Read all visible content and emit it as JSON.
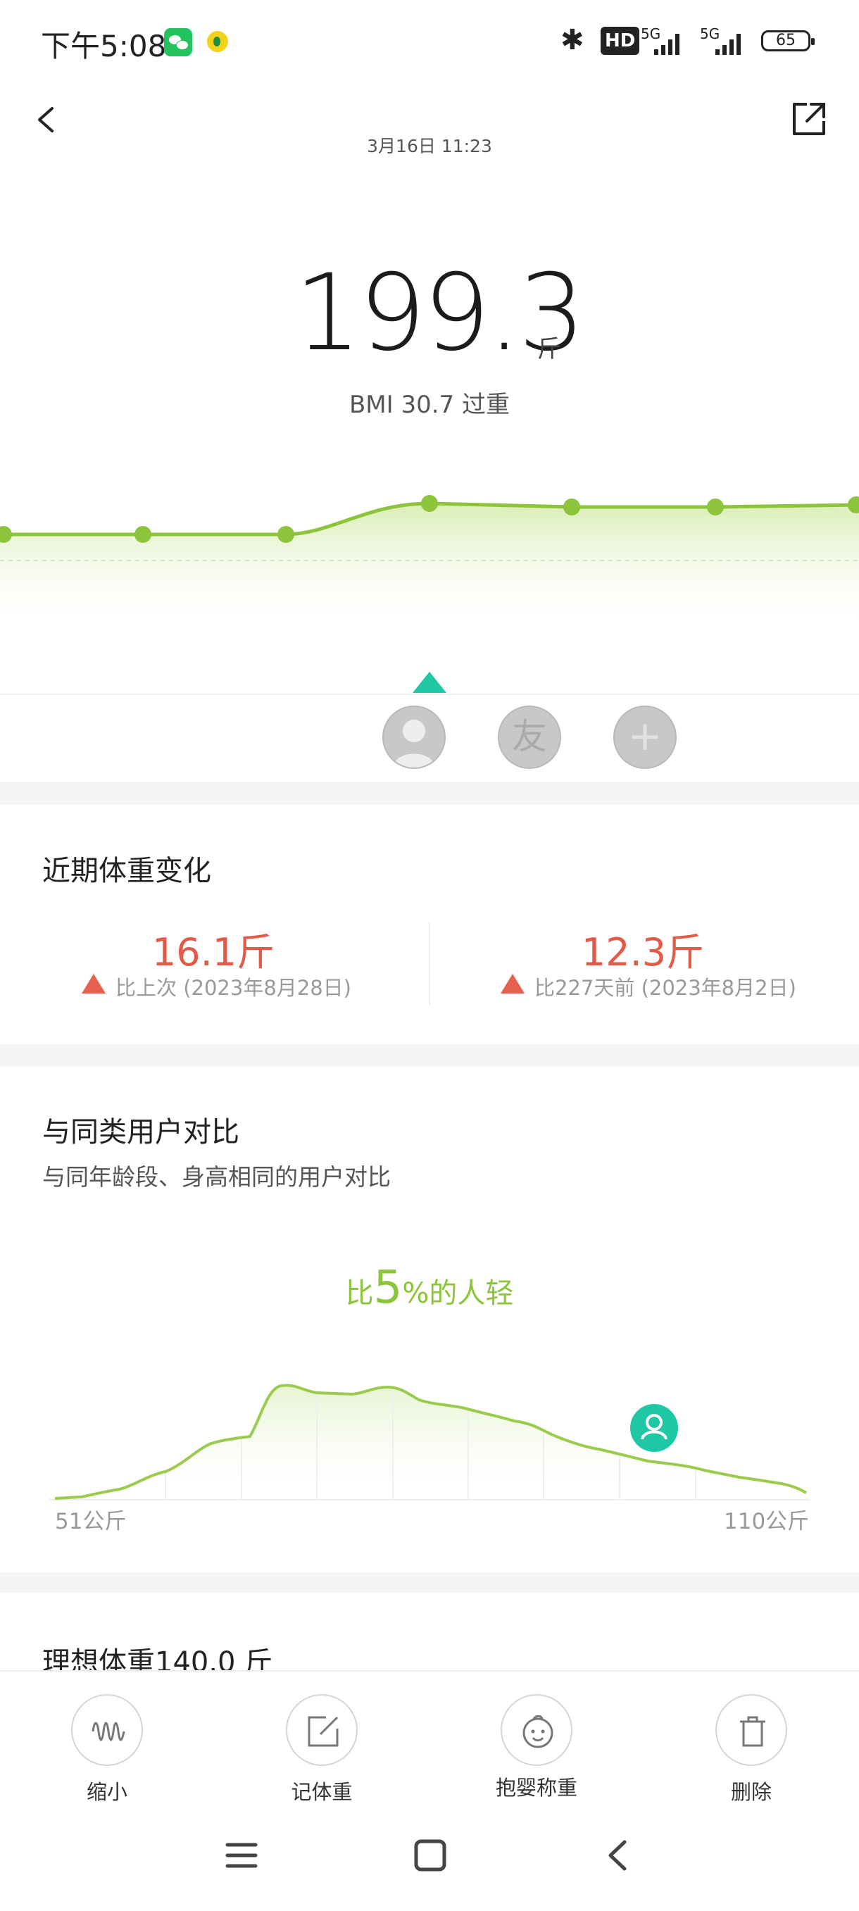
{
  "status_bar": {
    "time": "下午5:08",
    "hd_badge": "HD",
    "net1": "5G",
    "net2": "5G",
    "battery": "65"
  },
  "header": {
    "date": "3月16日 11:23"
  },
  "measurement": {
    "weight": "199.3",
    "unit": "斤",
    "bmi": "BMI 30.7  过重"
  },
  "users": {
    "friend_label": "友",
    "add_label": "+"
  },
  "recent_change": {
    "title": "近期体重变化",
    "items": [
      {
        "value": "16.1斤",
        "label": "比上次 (2023年8月28日)"
      },
      {
        "value": "12.3斤",
        "label": "比227天前 (2023年8月2日)"
      }
    ]
  },
  "comparison": {
    "title": "与同类用户对比",
    "subtitle": "与同年龄段、身高相同的用户对比",
    "prefix": "比",
    "percent": "5",
    "suffix": "%的人轻",
    "axis_min": "51公斤",
    "axis_max": "110公斤"
  },
  "ideal": {
    "title": "理想体重140.0 斤"
  },
  "toolbar": {
    "items": [
      {
        "label": "缩小"
      },
      {
        "label": "记体重"
      },
      {
        "label": "抱婴称重"
      },
      {
        "label": "删除"
      }
    ]
  },
  "colors": {
    "accent_green": "#8cc43b",
    "teal": "#1ec8a5",
    "warning_red": "#e35a48"
  }
}
